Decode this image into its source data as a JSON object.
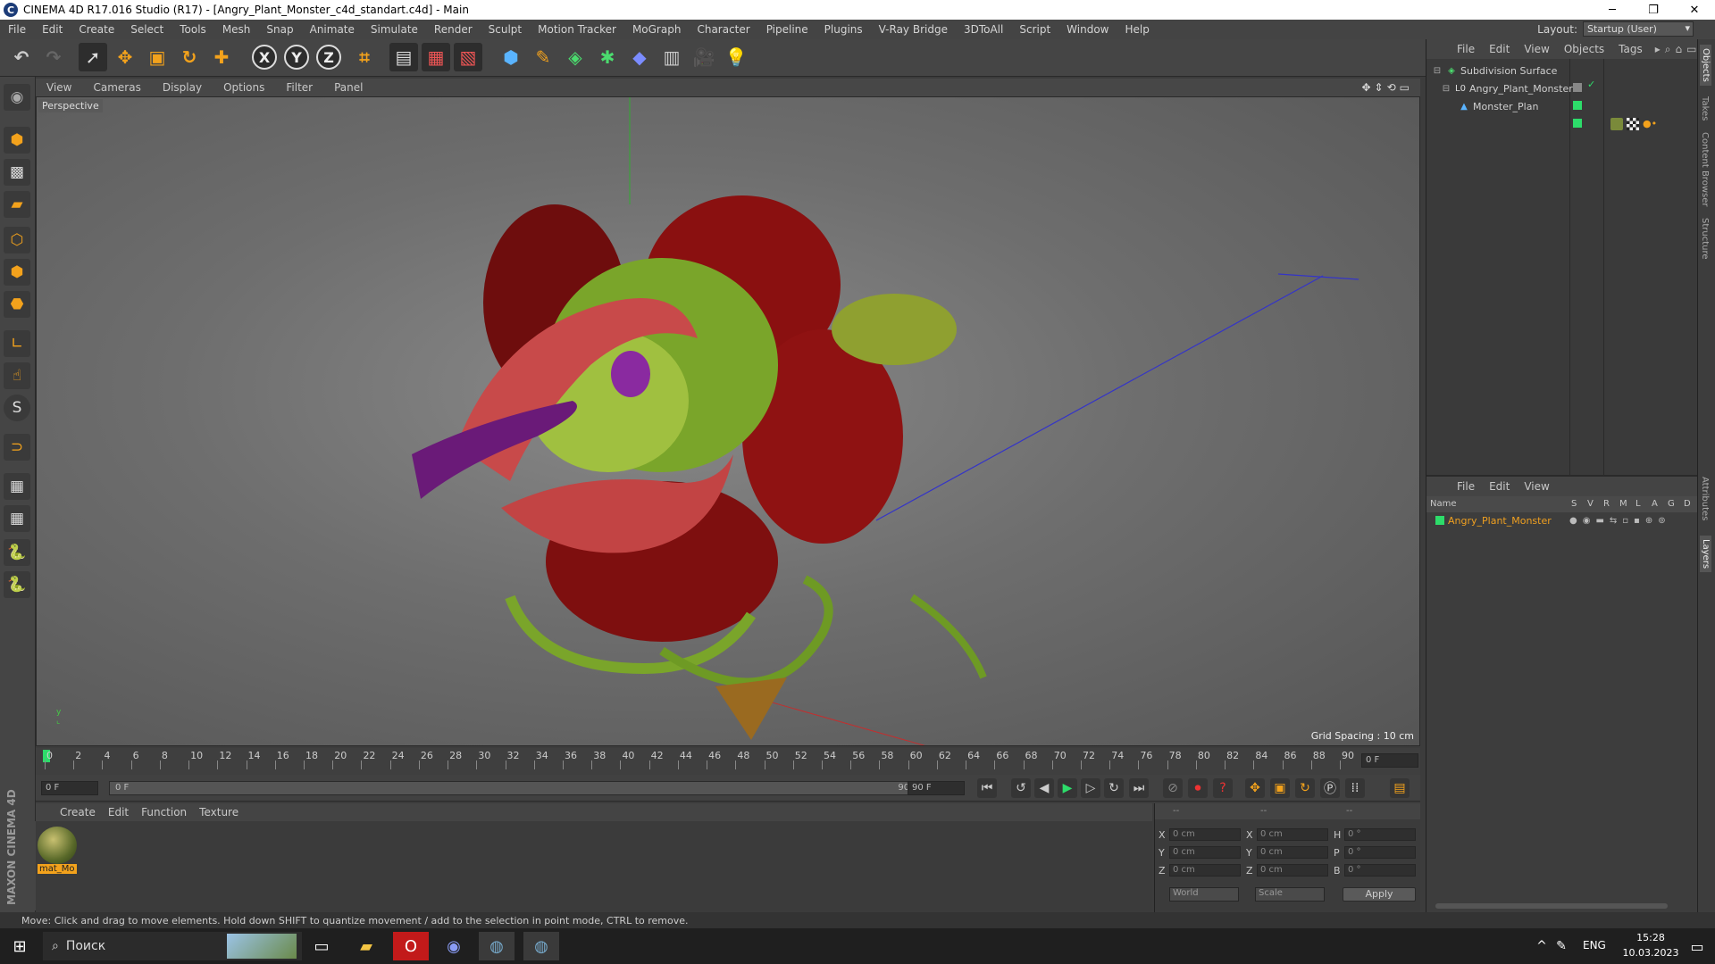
{
  "window": {
    "title": "CINEMA 4D R17.016 Studio (R17) - [Angry_Plant_Monster_c4d_standart.c4d] - Main",
    "logo": "C"
  },
  "menubar": {
    "items": [
      "File",
      "Edit",
      "Create",
      "Select",
      "Tools",
      "Mesh",
      "Snap",
      "Animate",
      "Simulate",
      "Render",
      "Sculpt",
      "Motion Tracker",
      "MoGraph",
      "Character",
      "Pipeline",
      "Plugins",
      "V-Ray Bridge",
      "3DToAll",
      "Script",
      "Window",
      "Help"
    ],
    "layout_label": "Layout:",
    "layout_value": "Startup (User)"
  },
  "toolbar": {
    "axis_x": "X",
    "axis_y": "Y",
    "axis_z": "Z"
  },
  "viewport": {
    "menu": [
      "View",
      "Cameras",
      "Display",
      "Options",
      "Filter",
      "Panel"
    ],
    "label": "Perspective",
    "grid_spacing": "Grid Spacing : 10 cm"
  },
  "objects_panel": {
    "menu": [
      "File",
      "Edit",
      "View",
      "Objects",
      "Tags"
    ],
    "items": [
      "Subdivision Surface",
      "Angry_Plant_Monster",
      "Monster_Plan"
    ]
  },
  "layers_panel": {
    "menu": [
      "File",
      "Edit",
      "View"
    ],
    "headers": [
      "Name",
      "S",
      "V",
      "R",
      "M",
      "L",
      "A",
      "G",
      "D"
    ],
    "row": "Angry_Plant_Monster"
  },
  "side_tabs": [
    "Objects",
    "Takes",
    "Content Browser",
    "Structure",
    "Attributes",
    "Layers"
  ],
  "timeline": {
    "ticks": [
      "0",
      "2",
      "4",
      "6",
      "8",
      "10",
      "12",
      "14",
      "16",
      "18",
      "20",
      "22",
      "24",
      "26",
      "28",
      "30",
      "32",
      "34",
      "36",
      "38",
      "40",
      "42",
      "44",
      "46",
      "48",
      "50",
      "52",
      "54",
      "56",
      "58",
      "60",
      "62",
      "64",
      "66",
      "68",
      "70",
      "72",
      "74",
      "76",
      "78",
      "80",
      "82",
      "84",
      "86",
      "88",
      "90"
    ],
    "frame_display": "0 F"
  },
  "transport": {
    "start": "0 F",
    "range_start": "0 F",
    "range_end": "90 F",
    "end": "90 F"
  },
  "material_panel": {
    "menu": [
      "Create",
      "Edit",
      "Function",
      "Texture"
    ],
    "material_name": "mat_Mo"
  },
  "coords": {
    "headers": [
      "--",
      "--",
      "--"
    ],
    "rows": [
      {
        "a": "X",
        "av": "0 cm",
        "b": "X",
        "bv": "0 cm",
        "c": "H",
        "cv": "0 °"
      },
      {
        "a": "Y",
        "av": "0 cm",
        "b": "Y",
        "bv": "0 cm",
        "c": "P",
        "cv": "0 °"
      },
      {
        "a": "Z",
        "av": "0 cm",
        "b": "Z",
        "bv": "0 cm",
        "c": "B",
        "cv": "0 °"
      }
    ],
    "space": "World",
    "mode": "Scale",
    "apply": "Apply"
  },
  "status": "Move: Click and drag to move elements. Hold down SHIFT to quantize movement / add to the selection in point mode, CTRL to remove.",
  "maxon": "MAXON CINEMA 4D",
  "taskbar": {
    "search": "Поиск",
    "lang": "ENG",
    "time": "15:28",
    "date": "10.03.2023"
  }
}
